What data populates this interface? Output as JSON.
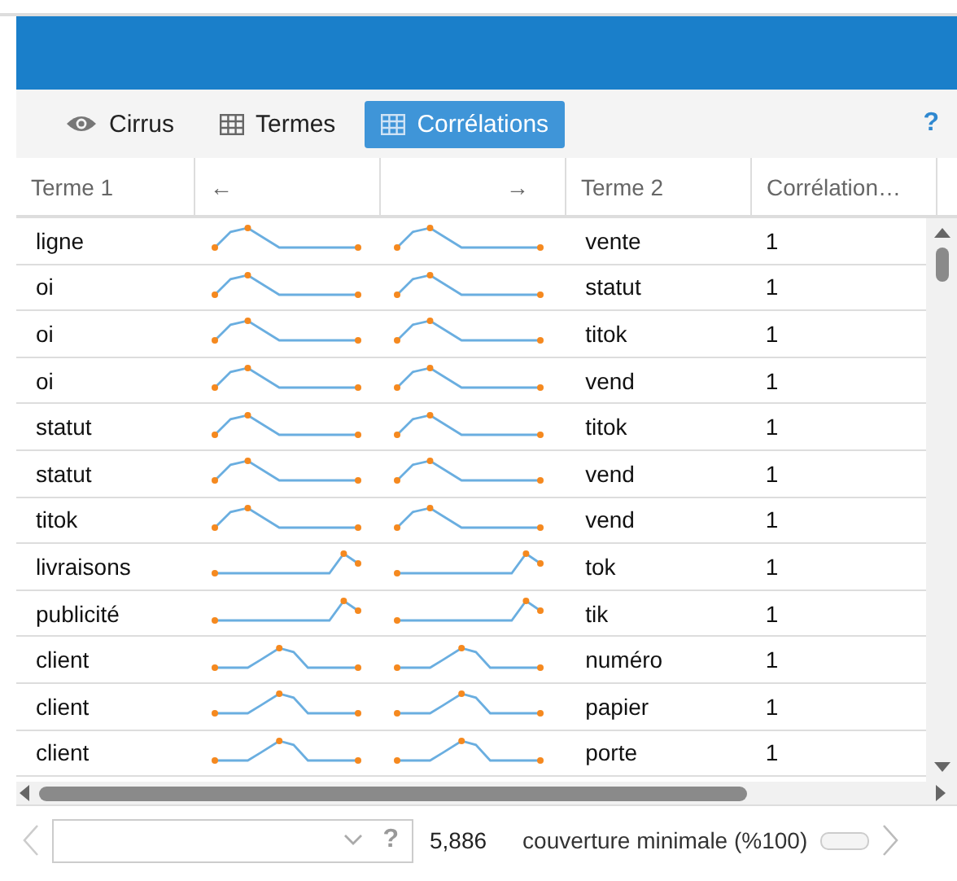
{
  "tabs": [
    {
      "label": "Cirrus",
      "kind": "eye",
      "selected": false
    },
    {
      "label": "Termes",
      "kind": "grid",
      "selected": false
    },
    {
      "label": "Corrélations",
      "kind": "grid",
      "selected": true
    }
  ],
  "help": "?",
  "table": {
    "columns": [
      "Terme 1",
      "←",
      "→",
      "Terme 2",
      "Corrélation…"
    ],
    "rows": [
      {
        "term1": "ligne",
        "kind": "early",
        "term2": "vente",
        "correlation": "1"
      },
      {
        "term1": "oi",
        "kind": "early",
        "term2": "statut",
        "correlation": "1"
      },
      {
        "term1": "oi",
        "kind": "early",
        "term2": "titok",
        "correlation": "1"
      },
      {
        "term1": "oi",
        "kind": "early",
        "term2": "vend",
        "correlation": "1"
      },
      {
        "term1": "statut",
        "kind": "early",
        "term2": "titok",
        "correlation": "1"
      },
      {
        "term1": "statut",
        "kind": "early",
        "term2": "vend",
        "correlation": "1"
      },
      {
        "term1": "titok",
        "kind": "early",
        "term2": "vend",
        "correlation": "1"
      },
      {
        "term1": "livraisons",
        "kind": "late",
        "term2": "tok",
        "correlation": "1"
      },
      {
        "term1": "publicité",
        "kind": "late",
        "term2": "tik",
        "correlation": "1"
      },
      {
        "term1": "client",
        "kind": "middle",
        "term2": "numéro",
        "correlation": "1"
      },
      {
        "term1": "client",
        "kind": "middle",
        "term2": "papier",
        "correlation": "1"
      },
      {
        "term1": "client",
        "kind": "middle",
        "term2": "porte",
        "correlation": "1"
      }
    ]
  },
  "footer": {
    "help": "?",
    "count": "5,886",
    "label": "couverture minimale (%100)"
  }
}
